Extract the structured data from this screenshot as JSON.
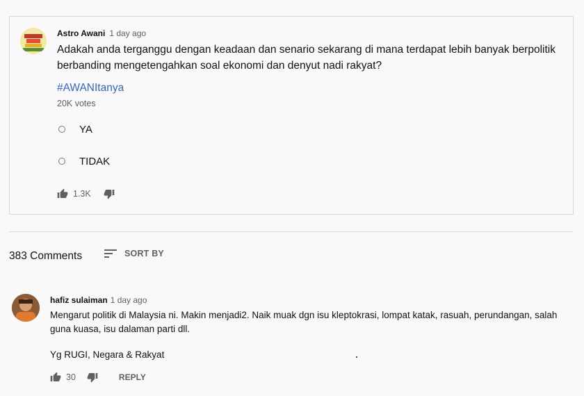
{
  "post": {
    "author": "Astro Awani",
    "time": "1 day ago",
    "text": "Adakah anda terganggu dengan keadaan dan senario sekarang di mana terdapat lebih banyak berpolitik berbanding mengetengahkan soal ekonomi dan denyut nadi rakyat?",
    "hashtag": "#AWANItanya",
    "votes": "20K votes",
    "options": [
      "YA",
      "TIDAK"
    ],
    "likes": "1.3K",
    "avatar_text": "astro awani"
  },
  "comments_section": {
    "count_label": "383 Comments",
    "sort_label": "SORT BY"
  },
  "comment": {
    "author": "hafiz sulaiman",
    "time": "1 day ago",
    "text": "Mengarut politik di Malaysia ni. Makin menjadi2. Naik muak dgn isu kleptokrasi, lompat katak, rasuah, perundangan, salah guna kuasa, isu dalaman parti dll.",
    "text2": "Yg RUGI, Negara & Rakyat",
    "likes": "30",
    "reply_label": "REPLY"
  },
  "colors": {
    "link": "#3366cc",
    "secondary_text": "#606060",
    "border": "#d8d8d8"
  }
}
